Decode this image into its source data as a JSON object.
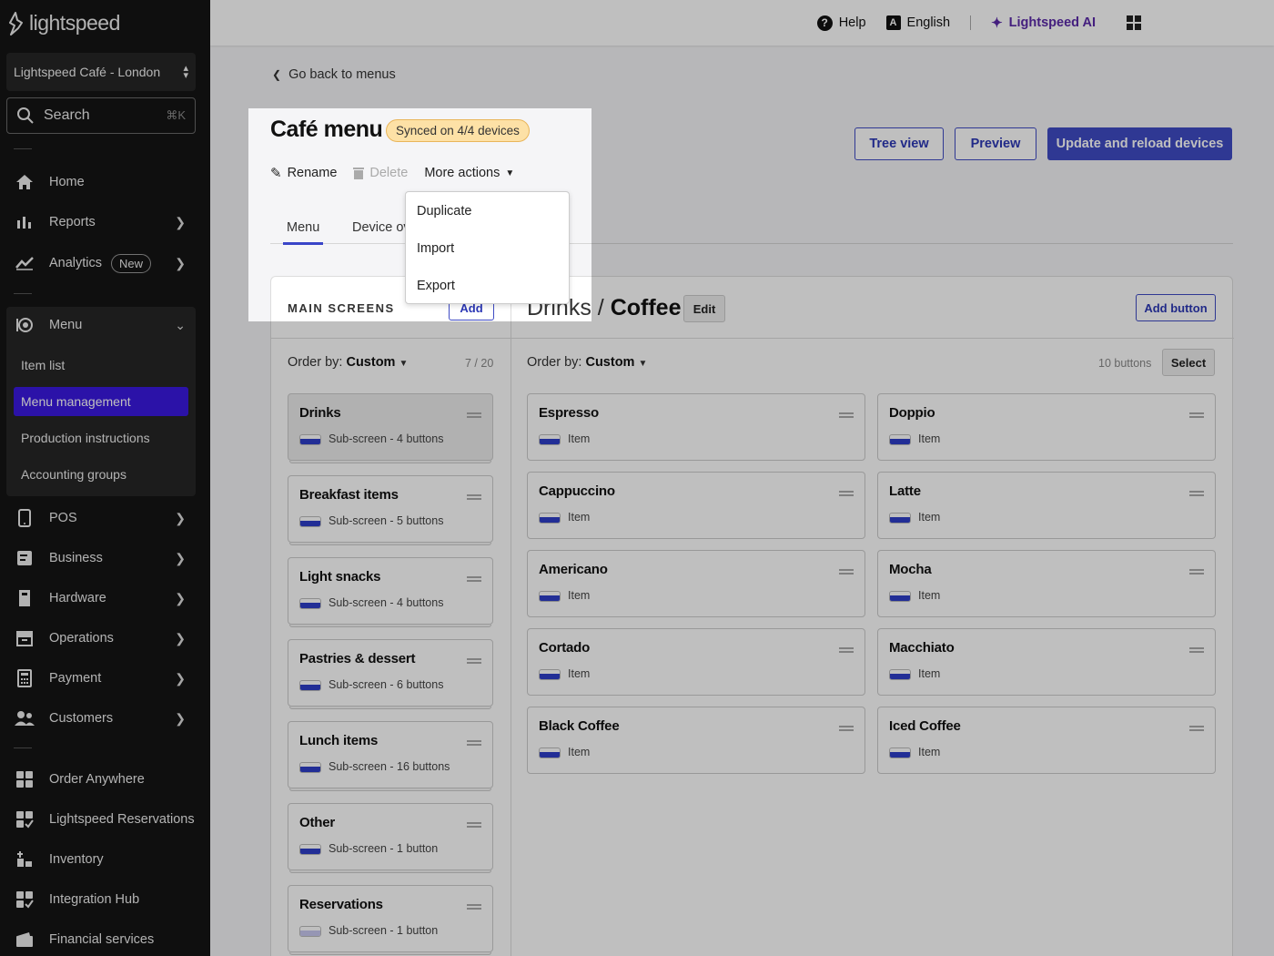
{
  "brand": {
    "name": "lightspeed"
  },
  "store": {
    "name": "Lightspeed Café - London"
  },
  "search": {
    "label": "Search",
    "shortcut": "⌘K"
  },
  "nav": {
    "home": "Home",
    "reports": "Reports",
    "analytics": "Analytics",
    "analytics_badge": "New",
    "menu": "Menu",
    "menu_sub": [
      "Item list",
      "Menu management",
      "Production instructions",
      "Accounting groups"
    ],
    "pos": "POS",
    "business": "Business",
    "hardware": "Hardware",
    "operations": "Operations",
    "payment": "Payment",
    "customers": "Customers",
    "order_anywhere": "Order Anywhere",
    "reservations": "Lightspeed Reservations",
    "inventory": "Inventory",
    "integration_hub": "Integration Hub",
    "financial": "Financial services"
  },
  "topbar": {
    "help": "Help",
    "language": "English",
    "ai": "Lightspeed AI"
  },
  "page": {
    "back": "Go back to menus",
    "title": "Café menu",
    "synced": "Synced on 4/4 devices",
    "rename": "Rename",
    "delete": "Delete",
    "more_actions": "More actions",
    "tabs": [
      "Menu",
      "Device ov"
    ],
    "tree_view": "Tree view",
    "preview": "Preview",
    "update": "Update and reload devices"
  },
  "dropdown": {
    "items": [
      "Duplicate",
      "Import",
      "Export"
    ]
  },
  "screens": {
    "title": "MAIN SCREENS",
    "add": "Add",
    "order_label": "Order by:",
    "order_value": "Custom",
    "count": "7 / 20",
    "items": [
      {
        "name": "Drinks",
        "sub": "Sub-screen - 4 buttons"
      },
      {
        "name": "Breakfast items",
        "sub": "Sub-screen - 5 buttons"
      },
      {
        "name": "Light snacks",
        "sub": "Sub-screen - 4 buttons"
      },
      {
        "name": "Pastries & dessert",
        "sub": "Sub-screen - 6 buttons"
      },
      {
        "name": "Lunch items",
        "sub": "Sub-screen - 16 buttons"
      },
      {
        "name": "Other",
        "sub": "Sub-screen - 1 button"
      },
      {
        "name": "Reservations",
        "sub": "Sub-screen - 1 button"
      }
    ]
  },
  "buttons": {
    "crumb_parent": "Drinks",
    "crumb_sep": " / ",
    "crumb_current": "Coffee",
    "edit": "Edit",
    "add_button": "Add button",
    "order_label": "Order by:",
    "order_value": "Custom",
    "count": "10 buttons",
    "select": "Select",
    "items": [
      {
        "name": "Espresso",
        "sub": "Item"
      },
      {
        "name": "Doppio",
        "sub": "Item"
      },
      {
        "name": "Cappuccino",
        "sub": "Item"
      },
      {
        "name": "Latte",
        "sub": "Item"
      },
      {
        "name": "Americano",
        "sub": "Item"
      },
      {
        "name": "Mocha",
        "sub": "Item"
      },
      {
        "name": "Cortado",
        "sub": "Item"
      },
      {
        "name": "Macchiato",
        "sub": "Item"
      },
      {
        "name": "Black Coffee",
        "sub": "Item"
      },
      {
        "name": "Iced Coffee",
        "sub": "Item"
      }
    ]
  },
  "colors": {
    "accent": "#3f4bc4",
    "active_nav": "#3a19e0",
    "ai": "#5b2aa8",
    "sync_badge": "#fde1a6"
  }
}
